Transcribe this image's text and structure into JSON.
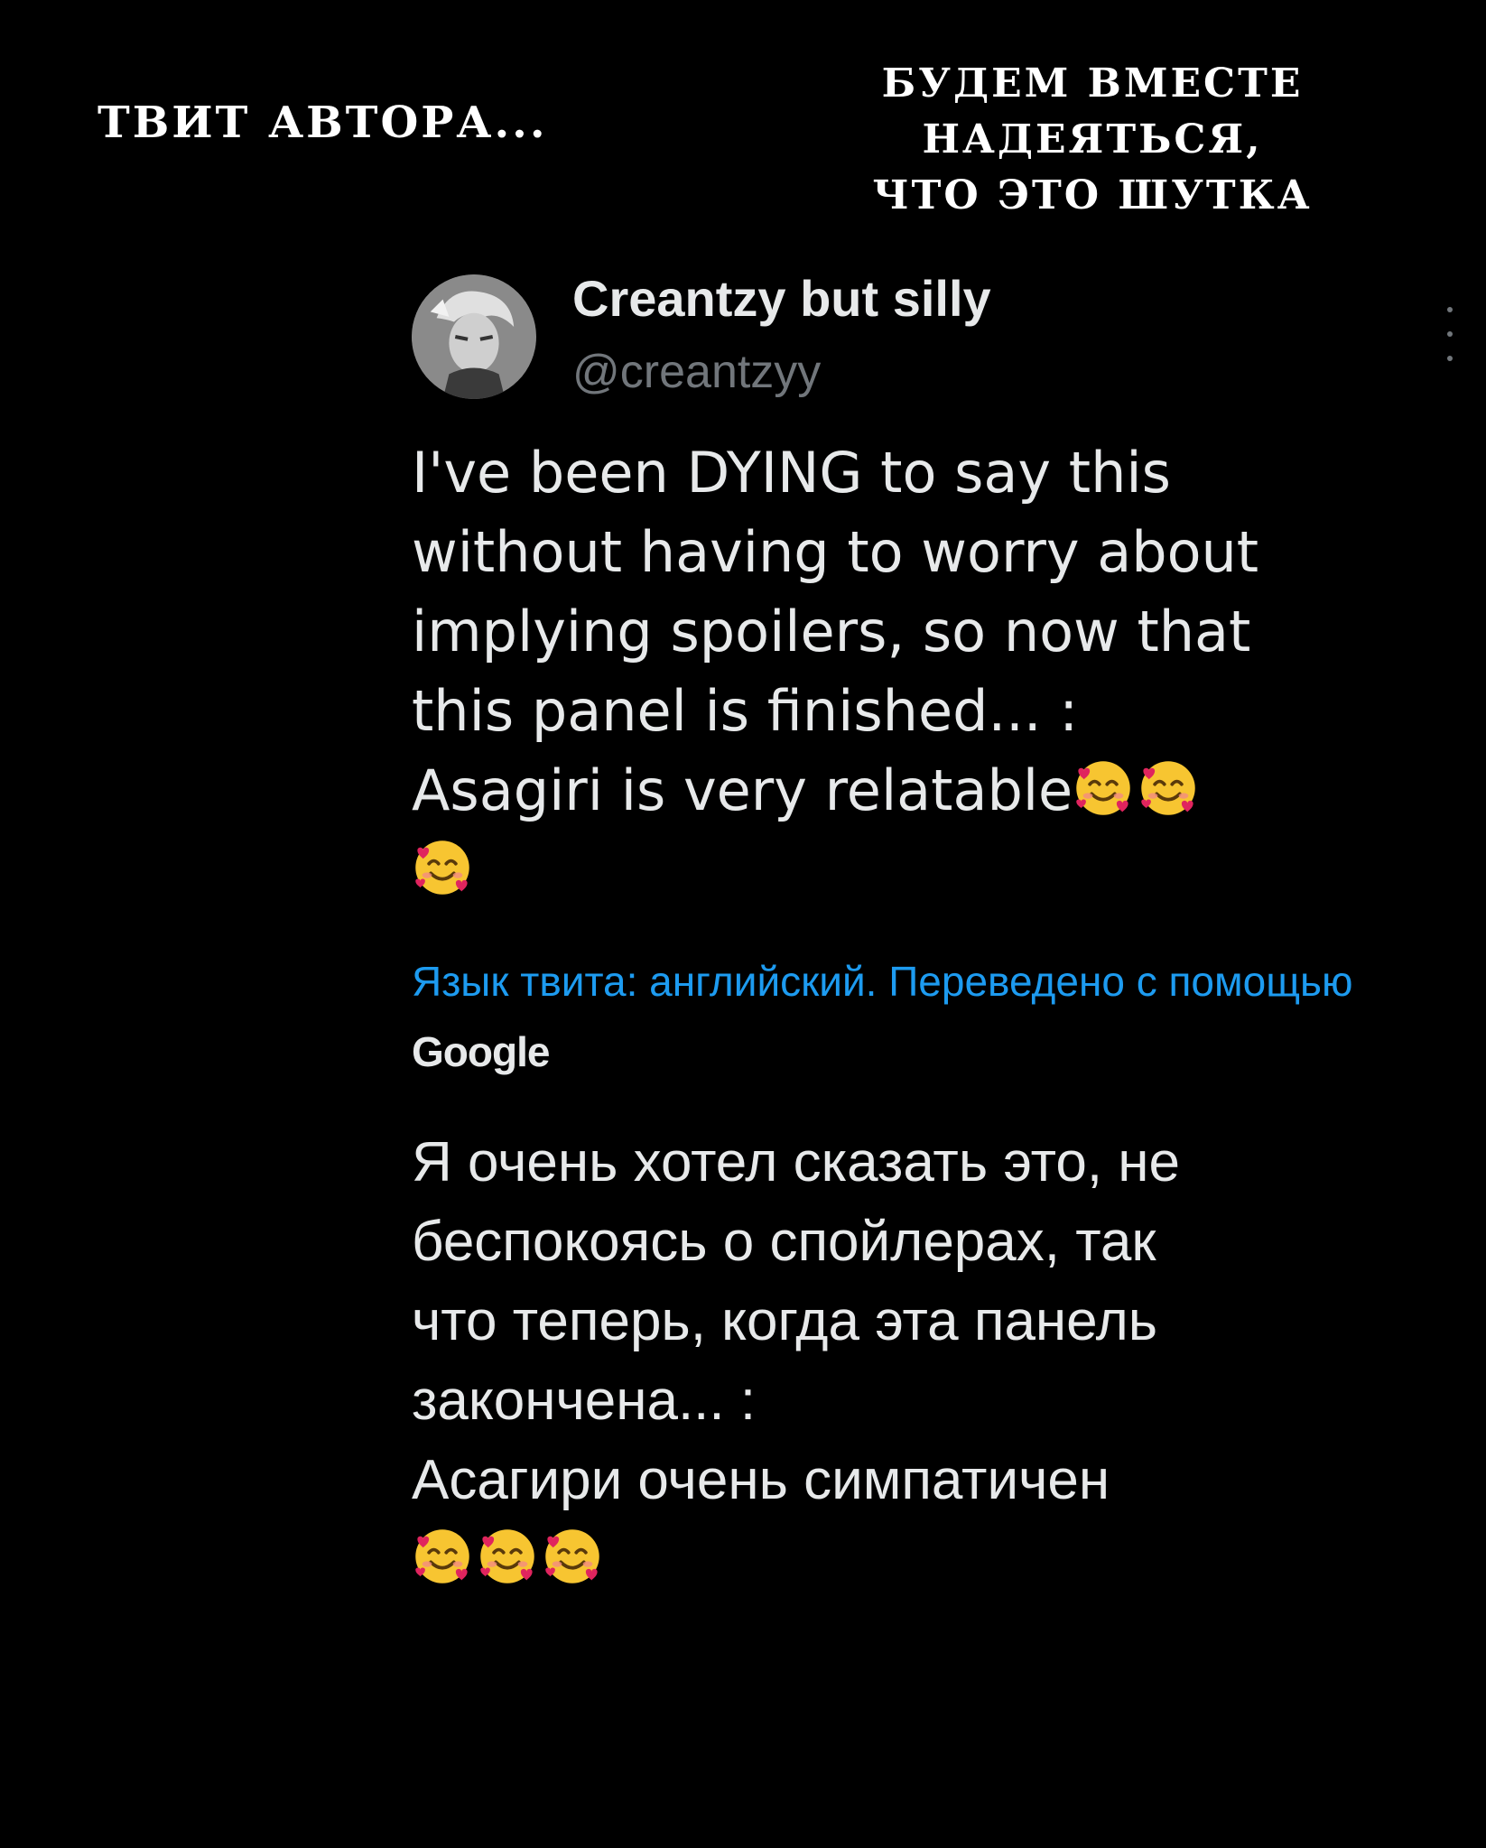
{
  "captions": {
    "left": "ТВИТ АВТОРА...",
    "right_lines": [
      "БУДЕМ ВМЕСТЕ",
      "НАДЕЯТЬСЯ,",
      "ЧТО ЭТО ШУТКА"
    ]
  },
  "tweet": {
    "author_name": "Creantzy but silly",
    "author_handle": "@creantzyy",
    "avatar_icon": "avatar-anime-character",
    "more_icon": "more-vertical-icon",
    "text_lines": [
      "I've been DYING to say this",
      "without having to worry about",
      "implying spoilers, so now that",
      "this panel is finished... :",
      "Asagiri is very relatable"
    ],
    "emoji_name": "smiling-face-with-hearts",
    "original_emoji_count": 3,
    "translation_note": "Язык твита: английский. Переведено с помощью",
    "translation_provider": "Google",
    "translated_lines": [
      "Я очень хотел сказать это, не",
      "беспокоясь о спойлерах, так",
      "что теперь, когда эта панель",
      "закончена... :",
      "Асагири очень симпатичен"
    ],
    "translated_emoji_count": 3
  },
  "colors": {
    "background": "#000000",
    "text": "#e7e9ea",
    "secondary": "#71767b",
    "link": "#1d9bf0"
  }
}
